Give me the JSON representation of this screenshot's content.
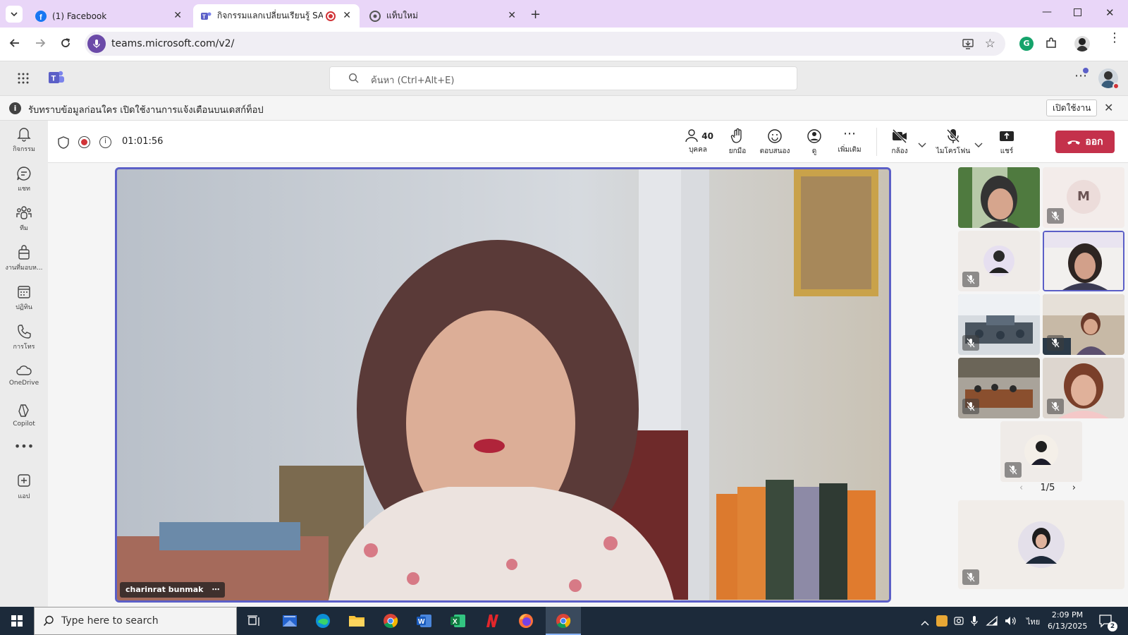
{
  "browser": {
    "tabs": [
      {
        "title": "(1) Facebook",
        "favicon": "facebook-icon"
      },
      {
        "title": "กิจกรรมแลกเปลี่ยนเรียนรู้ SAR",
        "favicon": "teams-icon",
        "active": true
      },
      {
        "title": "แท็บใหม่",
        "favicon": "chrome-icon"
      }
    ],
    "url": "teams.microsoft.com/v2/"
  },
  "teams": {
    "search_placeholder": "ค้นหา (Ctrl+Alt+E)",
    "notice_text": "รับทราบข้อมูลก่อนใคร เปิดใช้งานการแจ้งเตือนบนเดสก์ท็อป",
    "notice_button": "เปิดใช้งาน",
    "rail": [
      {
        "label": "กิจกรรม",
        "icon": "bell-icon"
      },
      {
        "label": "แชท",
        "icon": "chat-icon"
      },
      {
        "label": "ทีม",
        "icon": "teams-people-icon"
      },
      {
        "label": "งานที่มอบห...",
        "icon": "assignments-icon"
      },
      {
        "label": "ปฏิทิน",
        "icon": "calendar-icon"
      },
      {
        "label": "การโทร",
        "icon": "phone-icon"
      },
      {
        "label": "OneDrive",
        "icon": "cloud-icon"
      },
      {
        "label": "Copilot",
        "icon": "copilot-icon"
      },
      {
        "label": "แอป",
        "icon": "add-app-icon"
      }
    ]
  },
  "meeting": {
    "timer": "01:01:56",
    "people_count": "40",
    "controls": {
      "people": "บุคคล",
      "raise_hand": "ยกมือ",
      "react": "ตอบสนอง",
      "view": "ดู",
      "more": "เพิ่มเติม",
      "camera": "กล้อง",
      "mic": "ไมโครโฟน",
      "share": "แชร์",
      "leave": "ออก"
    },
    "speaker_name": "charinrat bunmak",
    "page_indicator": "1/5",
    "tile_m_initial": "M"
  },
  "taskbar": {
    "search_placeholder": "Type here to search",
    "time": "2:09 PM",
    "date": "6/13/2025",
    "language": "ไทย",
    "notification_count": "2"
  }
}
